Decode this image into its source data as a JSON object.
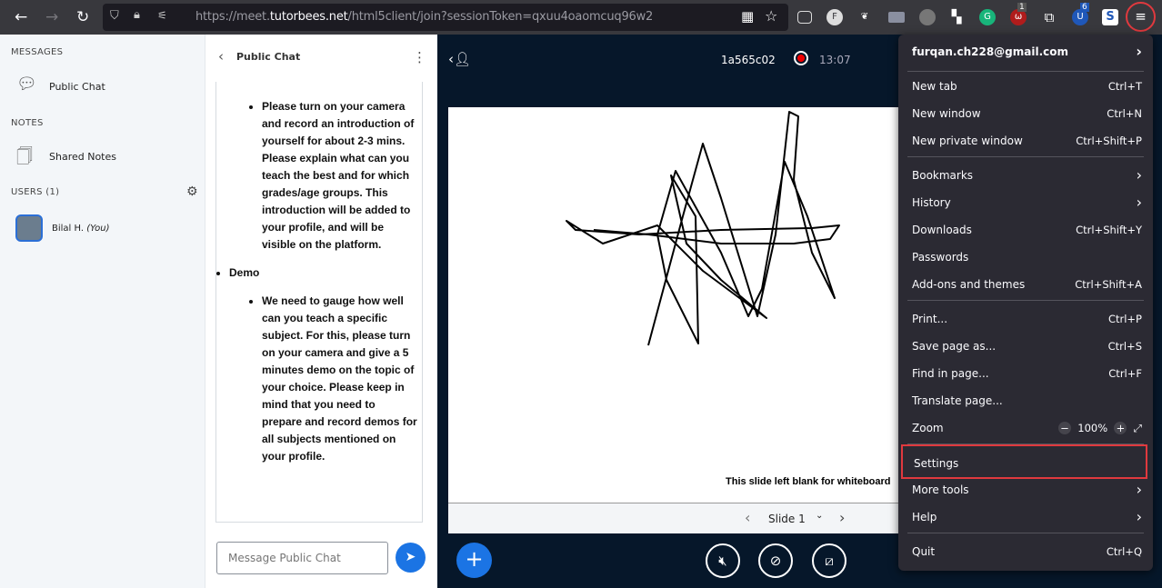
{
  "browser": {
    "url_prefix": "https://meet.",
    "url_domain": "tutorbees.net",
    "url_path": "/html5client/join?sessionToken=qxuu4oaomcuq96w2",
    "ext_badges": [
      "1",
      "6"
    ]
  },
  "sidebar": {
    "messages_heading": "MESSAGES",
    "public_chat": "Public Chat",
    "notes_heading": "NOTES",
    "shared_notes": "Shared Notes",
    "users_heading": "USERS (1)",
    "user_name": "Bilal H.",
    "user_you": "(You)"
  },
  "chat": {
    "title": "Public Chat",
    "item1": "Please turn on your camera and record an introduction of yourself for about 2-3 mins. Please explain what can you teach the best and for which grades/age groups. This introduction will be added to your profile, and will be visible on the platform.",
    "demo": "Demo",
    "item2_a": "We need to gauge how well can you teach a specific subject. For this, please turn on your camera and give a 5 minutes demo on the topic of your choice. Please keep in mind that you need to prepare and record demos for ",
    "item2_b": "all subjects mentioned on your profile",
    "item2_c": ".",
    "input_placeholder": "Message Public Chat"
  },
  "main": {
    "meeting_id": "1a565c02",
    "rec_time": "13:07",
    "slide_caption": "This slide left blank for whiteboard",
    "slide_label": "Slide 1"
  },
  "menu": {
    "account": "furqan.ch228@gmail.com",
    "items": [
      {
        "label": "New tab",
        "shortcut": "Ctrl+T"
      },
      {
        "label": "New window",
        "shortcut": "Ctrl+N"
      },
      {
        "label": "New private window",
        "shortcut": "Ctrl+Shift+P"
      },
      {
        "label": "Bookmarks",
        "shortcut": "›"
      },
      {
        "label": "History",
        "shortcut": "›"
      },
      {
        "label": "Downloads",
        "shortcut": "Ctrl+Shift+Y"
      },
      {
        "label": "Passwords",
        "shortcut": ""
      },
      {
        "label": "Add-ons and themes",
        "shortcut": "Ctrl+Shift+A"
      },
      {
        "label": "Print...",
        "shortcut": "Ctrl+P"
      },
      {
        "label": "Save page as...",
        "shortcut": "Ctrl+S"
      },
      {
        "label": "Find in page...",
        "shortcut": "Ctrl+F"
      },
      {
        "label": "Translate page...",
        "shortcut": ""
      },
      {
        "label": "Zoom",
        "shortcut": ""
      },
      {
        "label": "Settings",
        "shortcut": ""
      },
      {
        "label": "More tools",
        "shortcut": "›"
      },
      {
        "label": "Help",
        "shortcut": "›"
      },
      {
        "label": "Quit",
        "shortcut": "Ctrl+Q"
      }
    ],
    "zoom_level": "100%",
    "highlight_color": "#e0393e"
  }
}
